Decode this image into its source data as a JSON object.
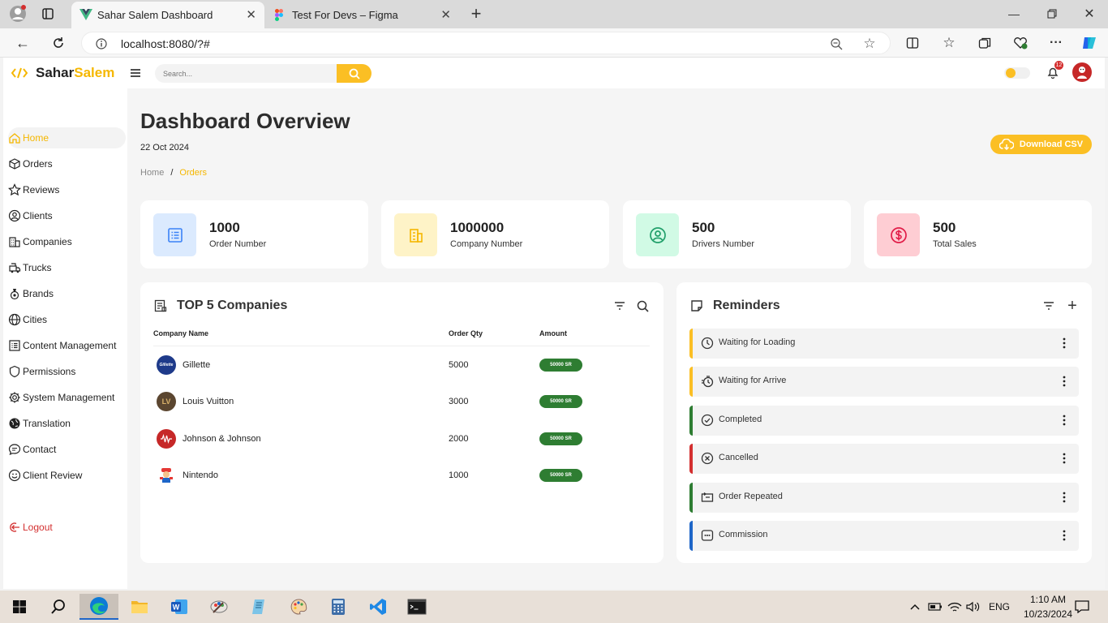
{
  "browser": {
    "tabs": [
      {
        "label": "Sahar Salem Dashboard",
        "icon": "vue-logo-icon",
        "active": true
      },
      {
        "label": "Test For Devs – Figma",
        "icon": "figma-logo-icon",
        "active": false
      }
    ],
    "url": "localhost:8080/?#"
  },
  "app": {
    "logo_part1": "Sahar",
    "logo_part2": "Salem",
    "search_placeholder": "Search...",
    "notification_count": "12",
    "colors": {
      "accent": "#fbbf24",
      "brand": "#f5b700",
      "green": "#2e7d32"
    }
  },
  "sidebar": {
    "items": [
      {
        "label": "Home",
        "icon": "home-icon",
        "active": true
      },
      {
        "label": "Orders",
        "icon": "box-icon"
      },
      {
        "label": "Reviews",
        "icon": "star-icon"
      },
      {
        "label": "Clients",
        "icon": "user-circle-icon"
      },
      {
        "label": "Companies",
        "icon": "building-icon"
      },
      {
        "label": "Trucks",
        "icon": "truck-icon"
      },
      {
        "label": "Brands",
        "icon": "brand-icon"
      },
      {
        "label": "Cities",
        "icon": "globe-icon"
      },
      {
        "label": "Content Management",
        "icon": "list-icon"
      },
      {
        "label": "Permissions",
        "icon": "shield-icon"
      },
      {
        "label": "System Management",
        "icon": "gear-icon"
      },
      {
        "label": "Translation",
        "icon": "translate-globe-icon"
      },
      {
        "label": "Contact",
        "icon": "chat-icon"
      },
      {
        "label": "Client Review",
        "icon": "smile-icon"
      }
    ],
    "logout": "Logout"
  },
  "main": {
    "title": "Dashboard Overview",
    "date": "22 Oct 2024",
    "breadcrumb": {
      "home": "Home",
      "separator": "/",
      "current": "Orders"
    },
    "download_label": "Download CSV",
    "stats": [
      {
        "value": "1000",
        "label": "Order Number",
        "bg": "#dbeafe",
        "fg": "#3b82f6",
        "icon": "list-alt-icon"
      },
      {
        "value": "1000000",
        "label": "Company Number",
        "bg": "#fef3c7",
        "fg": "#f5b700",
        "icon": "building-icon"
      },
      {
        "value": "500",
        "label": "Drivers Number",
        "bg": "#d1fae5",
        "fg": "#22a06b",
        "icon": "user-circle-icon"
      },
      {
        "value": "500",
        "label": "Total Sales",
        "bg": "#fecdd3",
        "fg": "#e11d48",
        "icon": "dollar-icon"
      }
    ]
  },
  "companies": {
    "title": "TOP 5 Companies",
    "headers": {
      "name": "Company Name",
      "qty": "Order Qty",
      "amount": "Amount"
    },
    "rows": [
      {
        "name": "Gillette",
        "qty": "5000",
        "amount": "50000 SR",
        "avatar_bg": "#1e3a8a"
      },
      {
        "name": "Louis Vuitton",
        "qty": "3000",
        "amount": "50000 SR",
        "avatar_bg": "#5b4630"
      },
      {
        "name": "Johnson & Johnson",
        "qty": "2000",
        "amount": "50000 SR",
        "avatar_bg": "#c62828"
      },
      {
        "name": "Nintendo",
        "qty": "1000",
        "amount": "50000 SR",
        "avatar_bg": "#e53935"
      }
    ]
  },
  "reminders": {
    "title": "Reminders",
    "items": [
      {
        "label": "Waiting for Loading",
        "color": "#fbbf24",
        "icon": "clock-icon"
      },
      {
        "label": "Waiting for Arrive",
        "color": "#fbbf24",
        "icon": "stopwatch-icon"
      },
      {
        "label": "Completed",
        "color": "#2e7d32",
        "icon": "check-circle-icon"
      },
      {
        "label": "Cancelled",
        "color": "#d32f2f",
        "icon": "x-circle-icon"
      },
      {
        "label": "Order Repeated",
        "color": "#2e7d32",
        "icon": "repeat-icon"
      },
      {
        "label": "Commission",
        "color": "#1e66c8",
        "icon": "commission-icon"
      }
    ]
  },
  "taskbar": {
    "lang": "ENG",
    "time": "1:10 AM",
    "date": "10/23/2024"
  }
}
